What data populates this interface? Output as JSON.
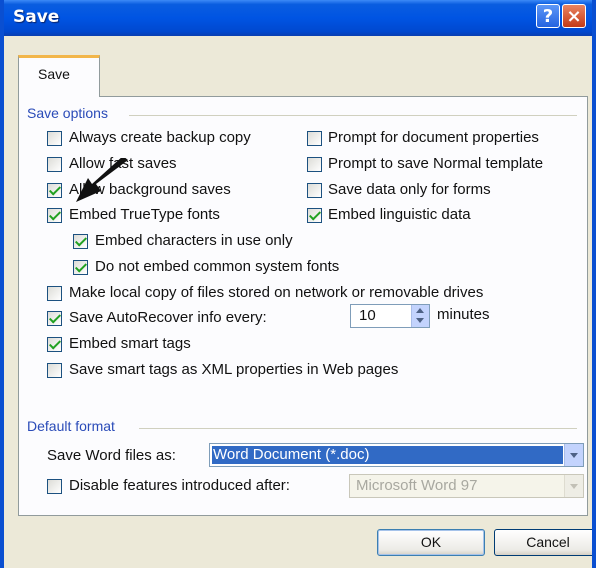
{
  "window": {
    "title": "Save",
    "help_icon": "?",
    "close_icon": "×"
  },
  "tab": {
    "label": "Save"
  },
  "save_options": {
    "group_label": "Save options",
    "left_items": [
      {
        "label": "Always create backup copy",
        "checked": false
      },
      {
        "label": "Allow fast saves",
        "checked": false
      },
      {
        "label": "Allow background saves",
        "checked": true
      },
      {
        "label": "Embed TrueType fonts",
        "checked": true
      }
    ],
    "right_items": [
      {
        "label": "Prompt for document properties",
        "checked": false
      },
      {
        "label": "Prompt to save Normal template",
        "checked": false
      },
      {
        "label": "Save data only for forms",
        "checked": false
      },
      {
        "label": "Embed linguistic data",
        "checked": true
      }
    ],
    "sub_items": [
      {
        "label": "Embed characters in use only",
        "checked": true
      },
      {
        "label": "Do not embed common system fonts",
        "checked": true
      }
    ],
    "bottom_items": [
      {
        "label": "Make local copy of files stored on network or removable drives",
        "checked": false
      },
      {
        "label": "Save AutoRecover info every:",
        "checked": true
      },
      {
        "label": "Embed smart tags",
        "checked": true
      },
      {
        "label": "Save smart tags as XML properties in Web pages",
        "checked": false
      }
    ],
    "autorecover": {
      "value": "10",
      "unit": "minutes"
    }
  },
  "default_format": {
    "group_label": "Default format",
    "save_as_label": "Save Word files as:",
    "save_as_value": "Word Document (*.doc)",
    "disable_features_label": "Disable features introduced after:",
    "disable_features_checked": false,
    "disable_features_value": "Microsoft Word 97"
  },
  "buttons": {
    "ok": "OK",
    "cancel": "Cancel"
  },
  "colors": {
    "titlebar": "#0054e3",
    "group_label": "#2a4bb8",
    "selection": "#316ac5",
    "check": "#21a121",
    "tab_accent": "#f2b64a"
  }
}
